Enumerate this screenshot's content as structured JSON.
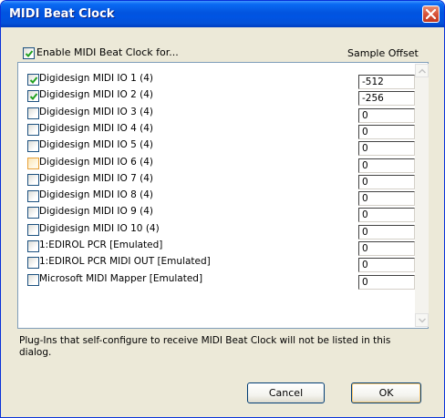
{
  "window": {
    "title": "MIDI Beat Clock"
  },
  "enable": {
    "label": "Enable MIDI Beat Clock for...",
    "checked": true
  },
  "header": {
    "sample_offset_label": "Sample Offset"
  },
  "devices": [
    {
      "label": "Digidesign MIDI IO 1 (4)",
      "checked": true,
      "focused": false,
      "offset": "-512"
    },
    {
      "label": "Digidesign MIDI IO 2 (4)",
      "checked": true,
      "focused": false,
      "offset": "-256"
    },
    {
      "label": "Digidesign MIDI IO 3 (4)",
      "checked": false,
      "focused": false,
      "offset": "0"
    },
    {
      "label": "Digidesign MIDI IO 4 (4)",
      "checked": false,
      "focused": false,
      "offset": "0"
    },
    {
      "label": "Digidesign MIDI IO 5 (4)",
      "checked": false,
      "focused": false,
      "offset": "0"
    },
    {
      "label": "Digidesign MIDI IO 6 (4)",
      "checked": false,
      "focused": true,
      "offset": "0"
    },
    {
      "label": "Digidesign MIDI IO 7 (4)",
      "checked": false,
      "focused": false,
      "offset": "0"
    },
    {
      "label": "Digidesign MIDI IO 8 (4)",
      "checked": false,
      "focused": false,
      "offset": "0"
    },
    {
      "label": "Digidesign MIDI IO 9 (4)",
      "checked": false,
      "focused": false,
      "offset": "0"
    },
    {
      "label": "Digidesign MIDI IO 10 (4)",
      "checked": false,
      "focused": false,
      "offset": "0"
    },
    {
      "label": "1:EDIROL PCR [Emulated]",
      "checked": false,
      "focused": false,
      "offset": "0"
    },
    {
      "label": "1:EDIROL PCR MIDI OUT [Emulated]",
      "checked": false,
      "focused": false,
      "offset": "0"
    },
    {
      "label": "Microsoft MIDI Mapper [Emulated]",
      "checked": false,
      "focused": false,
      "offset": "0"
    }
  ],
  "hint": {
    "text": "Plug-Ins that self-configure to receive MIDI Beat Clock will not be listed in this dialog."
  },
  "buttons": {
    "cancel_label": "Cancel",
    "ok_label": "OK"
  },
  "colors": {
    "titlebar": "#0054e3",
    "dialog_bg": "#ece9d8",
    "check_green": "#21a121",
    "focus_orange": "#e8a038"
  }
}
